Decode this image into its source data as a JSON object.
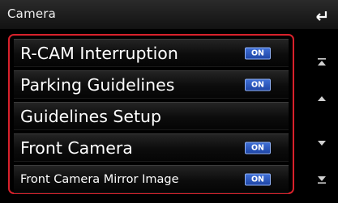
{
  "header": {
    "title": "Camera",
    "back_icon": "back-arrow-icon"
  },
  "items": [
    {
      "label": "R-CAM Interruption",
      "toggle": "ON",
      "size": "big"
    },
    {
      "label": "Parking Guidelines",
      "toggle": "ON",
      "size": "big"
    },
    {
      "label": "Guidelines Setup",
      "size": "big"
    },
    {
      "label": "Front Camera",
      "toggle": "ON",
      "size": "big"
    },
    {
      "label": "Front Camera Mirror Image",
      "toggle": "ON",
      "size": "small"
    }
  ],
  "scrollbar": {
    "icons": [
      "scroll-top-icon",
      "scroll-up-icon",
      "scroll-down-icon",
      "scroll-bottom-icon"
    ]
  },
  "colors": {
    "accent_border": "#d8212b",
    "toggle_on": "#2f5bc4"
  }
}
